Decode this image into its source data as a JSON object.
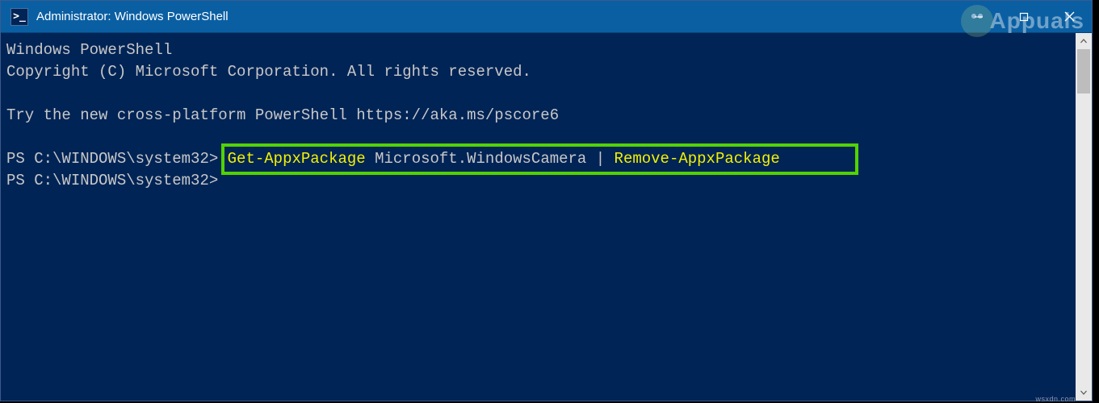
{
  "window": {
    "title": "Administrator: Windows PowerShell",
    "icon_glyph": ">_"
  },
  "terminal": {
    "banner_line1": "Windows PowerShell",
    "banner_line2": "Copyright (C) Microsoft Corporation. All rights reserved.",
    "try_line": "Try the new cross-platform PowerShell https://aka.ms/pscore6",
    "prompt1_prefix": "PS C:\\WINDOWS\\system32> ",
    "cmd_part1": "Get-AppxPackage",
    "cmd_part2": " Microsoft.WindowsCamera ",
    "cmd_pipe": "|",
    "cmd_part3": " Remove-AppxPackage",
    "prompt2": "PS C:\\WINDOWS\\system32>"
  },
  "watermark": {
    "text": "Appuals",
    "host": "wsxdn.com"
  }
}
